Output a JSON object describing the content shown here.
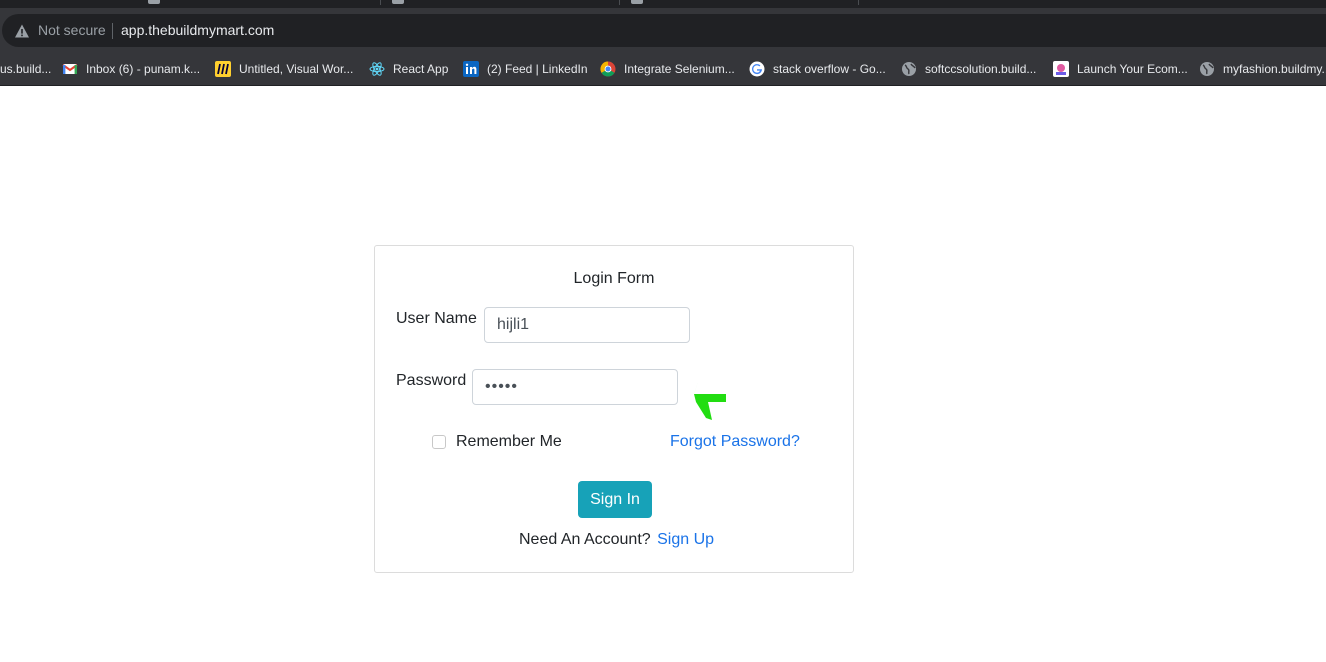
{
  "browser": {
    "security_label": "Not secure",
    "url": "app.thebuildmymart.com",
    "bookmarks": [
      {
        "label": "us.build...",
        "icon": "globe-icon"
      },
      {
        "label": "Inbox (6) - punam.k...",
        "icon": "gmail-icon"
      },
      {
        "label": "Untitled, Visual Wor...",
        "icon": "miro-icon"
      },
      {
        "label": "React App",
        "icon": "react-icon"
      },
      {
        "label": "(2) Feed | LinkedIn",
        "icon": "linkedin-icon"
      },
      {
        "label": "Integrate Selenium...",
        "icon": "chrome-icon"
      },
      {
        "label": "stack overflow - Go...",
        "icon": "google-icon"
      },
      {
        "label": "softccsolution.build...",
        "icon": "globe-icon"
      },
      {
        "label": "Launch Your Ecom...",
        "icon": "shop-icon"
      },
      {
        "label": "myfashion.buildmy...",
        "icon": "globe-icon"
      }
    ]
  },
  "login": {
    "title": "Login Form",
    "username_label": "User Name",
    "username_value": "hijli1",
    "password_label": "Password",
    "password_value": "•••••",
    "remember_label": "Remember Me",
    "forgot_link": "Forgot Password?",
    "signin_button": "Sign In",
    "need_account_text": "Need An Account?",
    "signup_link": "Sign Up"
  },
  "colors": {
    "primary_button": "#17a2b8",
    "link": "#1a73e8",
    "annotation_arrow": "#22dd11"
  }
}
